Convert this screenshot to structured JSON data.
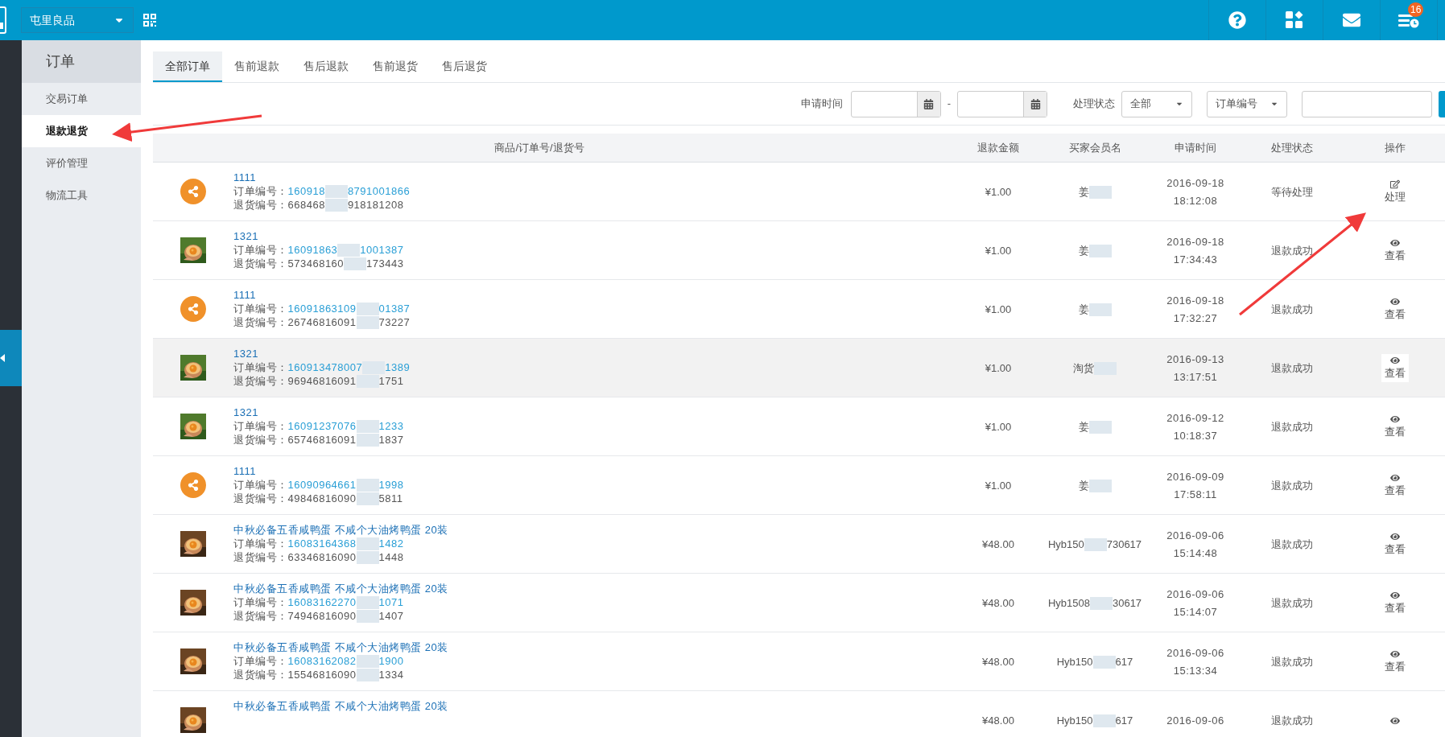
{
  "store_selector": {
    "label": "屯里良品"
  },
  "notification_badge": "16",
  "sidebar": {
    "title": "订单",
    "items": [
      {
        "label": "交易订单",
        "selected": false
      },
      {
        "label": "退款退货",
        "selected": true
      },
      {
        "label": "评价管理",
        "selected": false
      },
      {
        "label": "物流工具",
        "selected": false
      }
    ]
  },
  "tabs": [
    {
      "label": "全部订单",
      "selected": true
    },
    {
      "label": "售前退款",
      "selected": false
    },
    {
      "label": "售后退款",
      "selected": false
    },
    {
      "label": "售前退货",
      "selected": false
    },
    {
      "label": "售后退货",
      "selected": false
    }
  ],
  "filters": {
    "date_label": "申请时间",
    "date_separator": "-",
    "status_label": "处理状态",
    "status_select": "全部",
    "field_select": "订单编号"
  },
  "table": {
    "columns": [
      "商品/订单号/退货号",
      "退款金额",
      "买家会员名",
      "申请时间",
      "处理状态",
      "操作"
    ],
    "rows": [
      {
        "thumb": {
          "kind": "share"
        },
        "hovered": false,
        "title": "1111",
        "order_label": "订单编号：",
        "order_no": [
          "160918",
          "8791001866"
        ],
        "return_label": "退货编号：",
        "return_no": [
          "668468",
          "918181208"
        ],
        "amount": "¥1.00",
        "buyer": [
          "姜"
        ],
        "date": "2016-09-18",
        "time": "18:12:08",
        "status": "等待处理",
        "action": {
          "kind": "edit",
          "label": "处理"
        }
      },
      {
        "thumb": {
          "kind": "picture"
        },
        "hovered": false,
        "title": "1321",
        "order_label": "订单编号：",
        "order_no": [
          "16091863",
          "1001387"
        ],
        "return_label": "退货编号：",
        "return_no": [
          "573468160",
          "173443"
        ],
        "amount": "¥1.00",
        "buyer": [
          "姜"
        ],
        "date": "2016-09-18",
        "time": "17:34:43",
        "status": "退款成功",
        "action": {
          "kind": "view",
          "label": "查看"
        }
      },
      {
        "thumb": {
          "kind": "share"
        },
        "hovered": false,
        "title": "1111",
        "order_label": "订单编号：",
        "order_no": [
          "16091863109",
          "01387"
        ],
        "return_label": "退货编号：",
        "return_no": [
          "26746816091",
          "73227"
        ],
        "amount": "¥1.00",
        "buyer": [
          "姜"
        ],
        "date": "2016-09-18",
        "time": "17:32:27",
        "status": "退款成功",
        "action": {
          "kind": "view",
          "label": "查看"
        }
      },
      {
        "thumb": {
          "kind": "picture"
        },
        "hovered": true,
        "title": "1321",
        "order_label": "订单编号：",
        "order_no": [
          "160913478007",
          "1389"
        ],
        "return_label": "退货编号：",
        "return_no": [
          "96946816091",
          "1751"
        ],
        "amount": "¥1.00",
        "buyer": [
          "淘货"
        ],
        "date": "2016-09-13",
        "time": "13:17:51",
        "status": "退款成功",
        "action": {
          "kind": "view",
          "label": "查看"
        }
      },
      {
        "thumb": {
          "kind": "picture"
        },
        "hovered": false,
        "title": "1321",
        "order_label": "订单编号：",
        "order_no": [
          "16091237076",
          "1233"
        ],
        "return_label": "退货编号：",
        "return_no": [
          "65746816091",
          "1837"
        ],
        "amount": "¥1.00",
        "buyer": [
          "姜"
        ],
        "date": "2016-09-12",
        "time": "10:18:37",
        "status": "退款成功",
        "action": {
          "kind": "view",
          "label": "查看"
        }
      },
      {
        "thumb": {
          "kind": "share"
        },
        "hovered": false,
        "title": "1111",
        "order_label": "订单编号：",
        "order_no": [
          "16090964661",
          "1998"
        ],
        "return_label": "退货编号：",
        "return_no": [
          "49846816090",
          "5811"
        ],
        "amount": "¥1.00",
        "buyer": [
          "姜"
        ],
        "date": "2016-09-09",
        "time": "17:58:11",
        "status": "退款成功",
        "action": {
          "kind": "view",
          "label": "查看"
        }
      },
      {
        "thumb": {
          "kind": "picture"
        },
        "hovered": false,
        "title": "中秋必备五香咸鸭蛋 不咸个大油烤鸭蛋 20装",
        "order_label": "订单编号：",
        "order_no": [
          "16083164368",
          "1482"
        ],
        "return_label": "退货编号：",
        "return_no": [
          "63346816090",
          "1448"
        ],
        "amount": "¥48.00",
        "buyer": [
          "Hyb150",
          "730617"
        ],
        "date": "2016-09-06",
        "time": "15:14:48",
        "status": "退款成功",
        "action": {
          "kind": "view",
          "label": "查看"
        }
      },
      {
        "thumb": {
          "kind": "picture"
        },
        "hovered": false,
        "title": "中秋必备五香咸鸭蛋 不咸个大油烤鸭蛋 20装",
        "order_label": "订单编号：",
        "order_no": [
          "16083162270",
          "1071"
        ],
        "return_label": "退货编号：",
        "return_no": [
          "74946816090",
          "1407"
        ],
        "amount": "¥48.00",
        "buyer": [
          "Hyb1508",
          "30617"
        ],
        "date": "2016-09-06",
        "time": "15:14:07",
        "status": "退款成功",
        "action": {
          "kind": "view",
          "label": "查看"
        }
      },
      {
        "thumb": {
          "kind": "picture"
        },
        "hovered": false,
        "title": "中秋必备五香咸鸭蛋 不咸个大油烤鸭蛋 20装",
        "order_label": "订单编号：",
        "order_no": [
          "16083162082",
          "1900"
        ],
        "return_label": "退货编号：",
        "return_no": [
          "15546816090",
          "1334"
        ],
        "amount": "¥48.00",
        "buyer": [
          "Hyb150",
          "617"
        ],
        "date": "2016-09-06",
        "time": "15:13:34",
        "status": "退款成功",
        "action": {
          "kind": "view",
          "label": "查看"
        }
      },
      {
        "thumb": {
          "kind": "picture"
        },
        "hovered": false,
        "title": "中秋必备五香咸鸭蛋 不咸个大油烤鸭蛋 20装",
        "amount": "¥48.00",
        "buyer": [
          "Hyb150",
          "617"
        ],
        "date": "2016-09-06",
        "status": "退款成功",
        "action": {
          "kind": "view"
        }
      }
    ]
  }
}
